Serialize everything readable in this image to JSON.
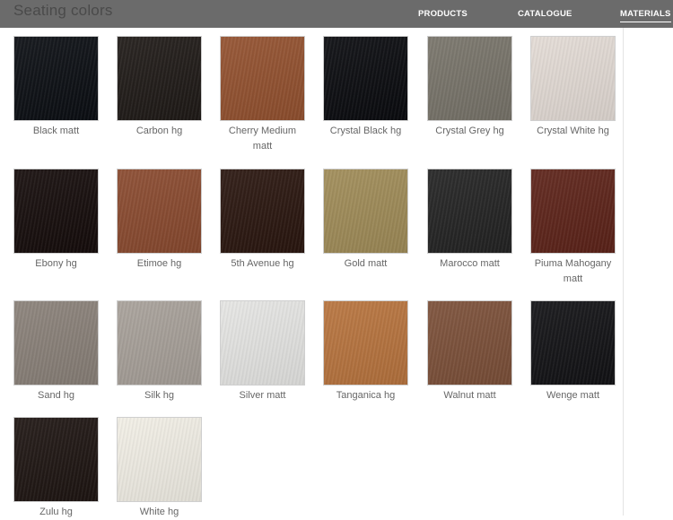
{
  "header": {
    "title": "Seating colors",
    "nav": [
      {
        "label": "PRODUCTS",
        "active": false
      },
      {
        "label": "CATALOGUE",
        "active": false
      },
      {
        "label": "MATERIALS",
        "active": true
      }
    ]
  },
  "swatches": [
    {
      "label": "Black matt",
      "color": "#0b0e13"
    },
    {
      "label": "Carbon hg",
      "color": "#1f1a17"
    },
    {
      "label": "Cherry Medium matt",
      "color": "#93512f"
    },
    {
      "label": "Crystal Black hg",
      "color": "#0a0b0f"
    },
    {
      "label": "Crystal Grey hg",
      "color": "#78746a"
    },
    {
      "label": "Crystal White hg",
      "color": "#e4dcd6"
    },
    {
      "label": "Ebony hg",
      "color": "#150c0b"
    },
    {
      "label": "Etimoe hg",
      "color": "#8a4a2f"
    },
    {
      "label": "5th Avenue hg",
      "color": "#2a160f"
    },
    {
      "label": "Gold matt",
      "color": "#a08c58"
    },
    {
      "label": "Marocco matt",
      "color": "#232323"
    },
    {
      "label": "Piuma Mahogany matt",
      "color": "#5d2319"
    },
    {
      "label": "Sand hg",
      "color": "#8a8179"
    },
    {
      "label": "Silk hg",
      "color": "#a8a19a"
    },
    {
      "label": "Silver matt",
      "color": "#e6e6e4"
    },
    {
      "label": "Tanganica hg",
      "color": "#b8743e"
    },
    {
      "label": "Walnut matt",
      "color": "#7c5039"
    },
    {
      "label": "Wenge matt",
      "color": "#121215"
    },
    {
      "label": "Zulu hg",
      "color": "#1e1512"
    },
    {
      "label": "White hg",
      "color": "#f2efe6"
    }
  ]
}
